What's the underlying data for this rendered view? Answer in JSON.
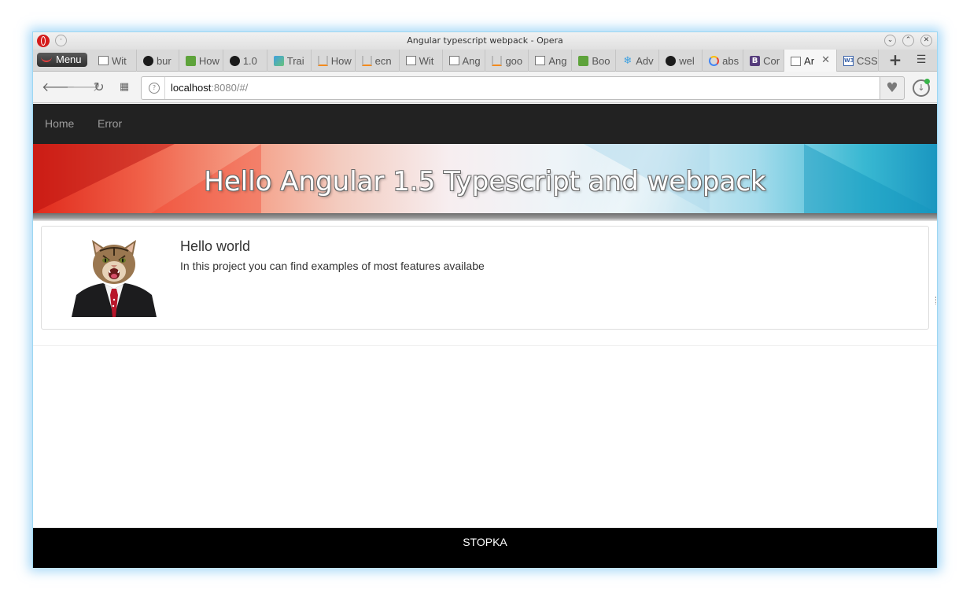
{
  "window": {
    "title": "Angular typescript webpack - Opera"
  },
  "browser": {
    "menu_label": "Menu",
    "tabs": [
      {
        "label": "Wit",
        "icon": "document-icon"
      },
      {
        "label": "bur",
        "icon": "github-icon"
      },
      {
        "label": "How",
        "icon": "w3schools-icon"
      },
      {
        "label": "1.0",
        "icon": "github-icon"
      },
      {
        "label": "Trai",
        "icon": "translate-icon"
      },
      {
        "label": "How",
        "icon": "stackoverflow-icon"
      },
      {
        "label": "ecn",
        "icon": "stackoverflow-icon"
      },
      {
        "label": "Wit",
        "icon": "document-icon"
      },
      {
        "label": "Ang",
        "icon": "document-icon"
      },
      {
        "label": "goo",
        "icon": "stackoverflow-icon"
      },
      {
        "label": "Ang",
        "icon": "document-icon"
      },
      {
        "label": "Boo",
        "icon": "w3schools-icon"
      },
      {
        "label": "Adv",
        "icon": "snowflake-icon"
      },
      {
        "label": "wel",
        "icon": "github-icon"
      },
      {
        "label": "abs",
        "icon": "google-icon"
      },
      {
        "label": "Cor",
        "icon": "bootstrap-icon"
      },
      {
        "label": "Ar",
        "icon": "document-icon",
        "active": true
      },
      {
        "label": "CSS",
        "icon": "w3c-icon"
      }
    ],
    "url_host": "localhost",
    "url_rest": ":8080/#/"
  },
  "page": {
    "nav": {
      "home": "Home",
      "error": "Error"
    },
    "hero_title": "Hello Angular 1.5 Typescript and webpack",
    "card": {
      "title": "Hello world",
      "text": "In this project you can find examples of most features availabe"
    },
    "footer": "STOPKA"
  },
  "colors": {
    "navbar_bg": "#222222",
    "nav_link": "#9d9d9d",
    "footer_bg": "#000000",
    "window_glow": "#9dd7f2"
  }
}
